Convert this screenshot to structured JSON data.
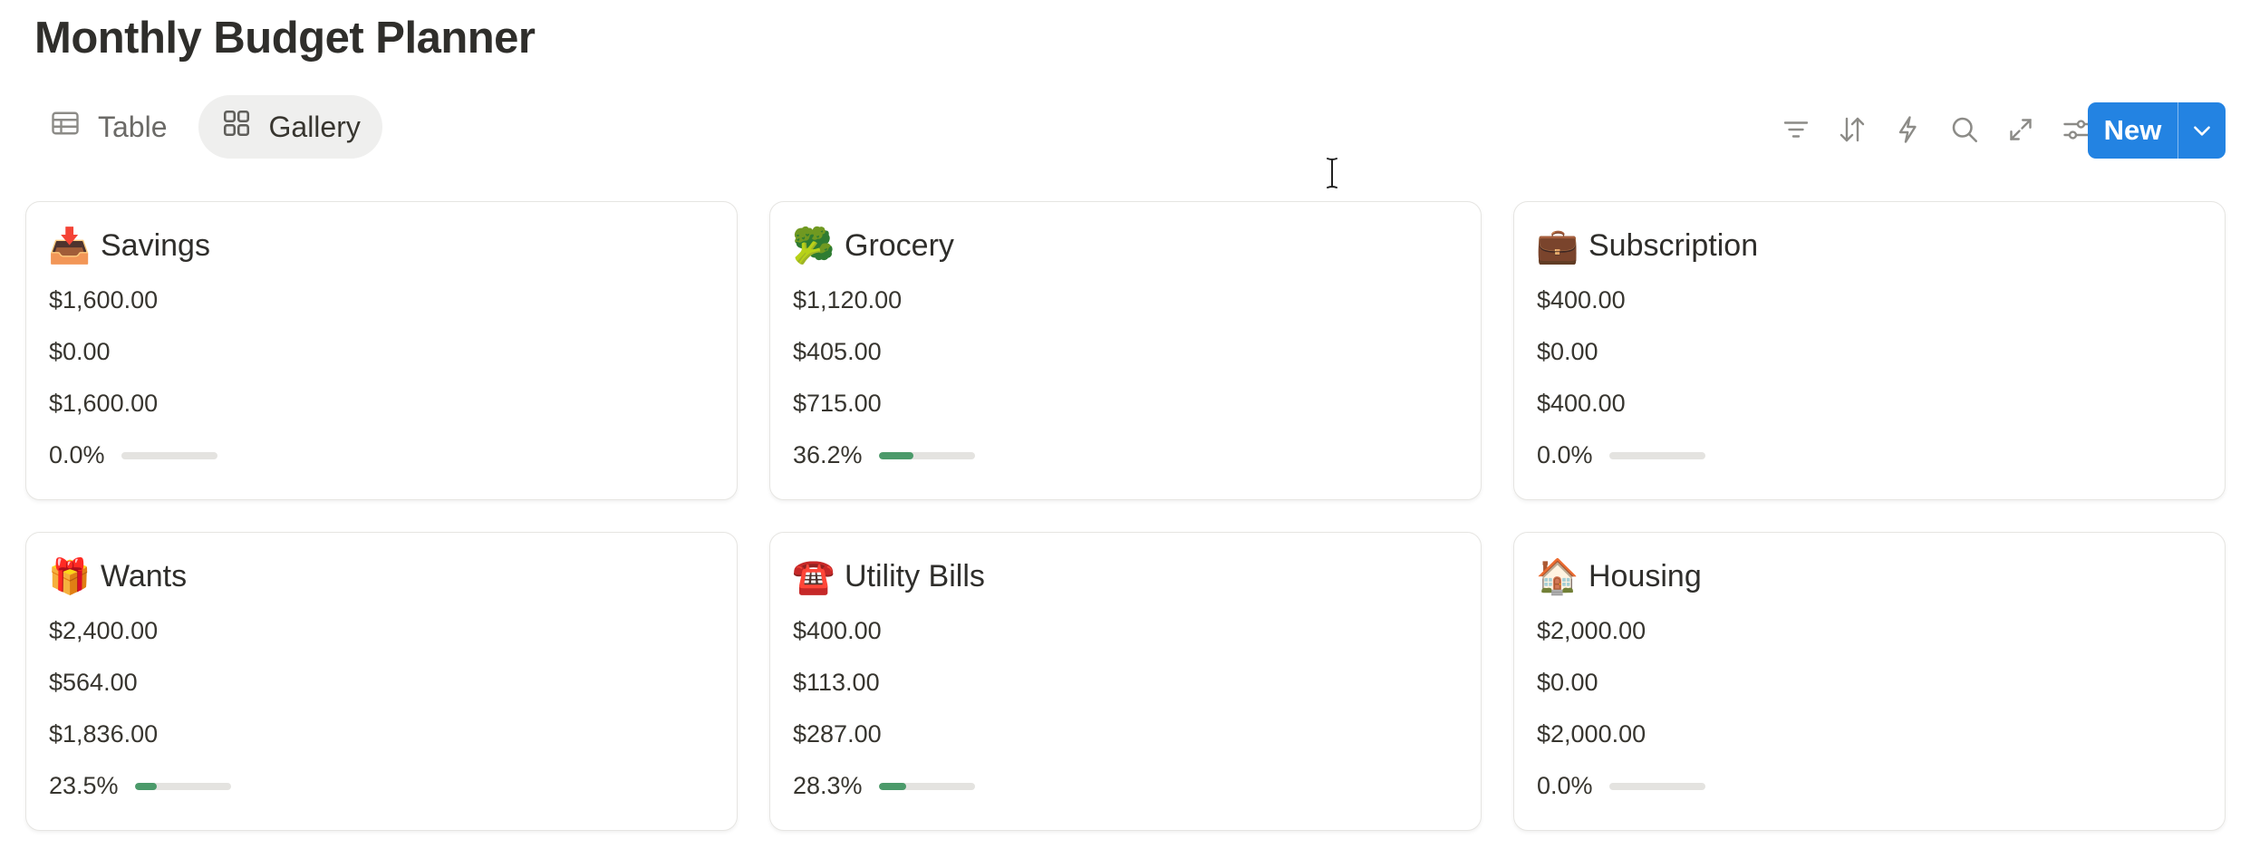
{
  "page": {
    "title": "Monthly Budget Planner"
  },
  "views": [
    {
      "label": "Table",
      "icon": "table-icon",
      "active": false
    },
    {
      "label": "Gallery",
      "icon": "gallery-icon",
      "active": true
    }
  ],
  "toolbar": {
    "icons": [
      "filter-icon",
      "sort-icon",
      "automation-icon",
      "search-icon",
      "expand-icon",
      "settings-icon"
    ],
    "new_label": "New",
    "new_color": "#2383e2"
  },
  "colors": {
    "progress_fill": "#4b9a6a",
    "progress_track": "#e4e3e0"
  },
  "cards": [
    {
      "emoji": "📥",
      "icon": "inbox-tray-icon",
      "title": "Savings",
      "budget": "$1,600.00",
      "spent": "$0.00",
      "remaining": "$1,600.00",
      "percent": "0.0%",
      "progress": 0.0
    },
    {
      "emoji": "🥦",
      "icon": "broccoli-icon",
      "title": "Grocery",
      "budget": "$1,120.00",
      "spent": "$405.00",
      "remaining": "$715.00",
      "percent": "36.2%",
      "progress": 0.362
    },
    {
      "emoji": "💼",
      "icon": "briefcase-icon",
      "title": "Subscription",
      "budget": "$400.00",
      "spent": "$0.00",
      "remaining": "$400.00",
      "percent": "0.0%",
      "progress": 0.0
    },
    {
      "emoji": "🎁",
      "icon": "gift-icon",
      "title": "Wants",
      "budget": "$2,400.00",
      "spent": "$564.00",
      "remaining": "$1,836.00",
      "percent": "23.5%",
      "progress": 0.235
    },
    {
      "emoji": "☎️",
      "icon": "telephone-icon",
      "title": "Utility Bills",
      "budget": "$400.00",
      "spent": "$113.00",
      "remaining": "$287.00",
      "percent": "28.3%",
      "progress": 0.283
    },
    {
      "emoji": "🏠",
      "icon": "house-icon",
      "title": "Housing",
      "budget": "$2,000.00",
      "spent": "$0.00",
      "remaining": "$2,000.00",
      "percent": "0.0%",
      "progress": 0.0
    }
  ]
}
